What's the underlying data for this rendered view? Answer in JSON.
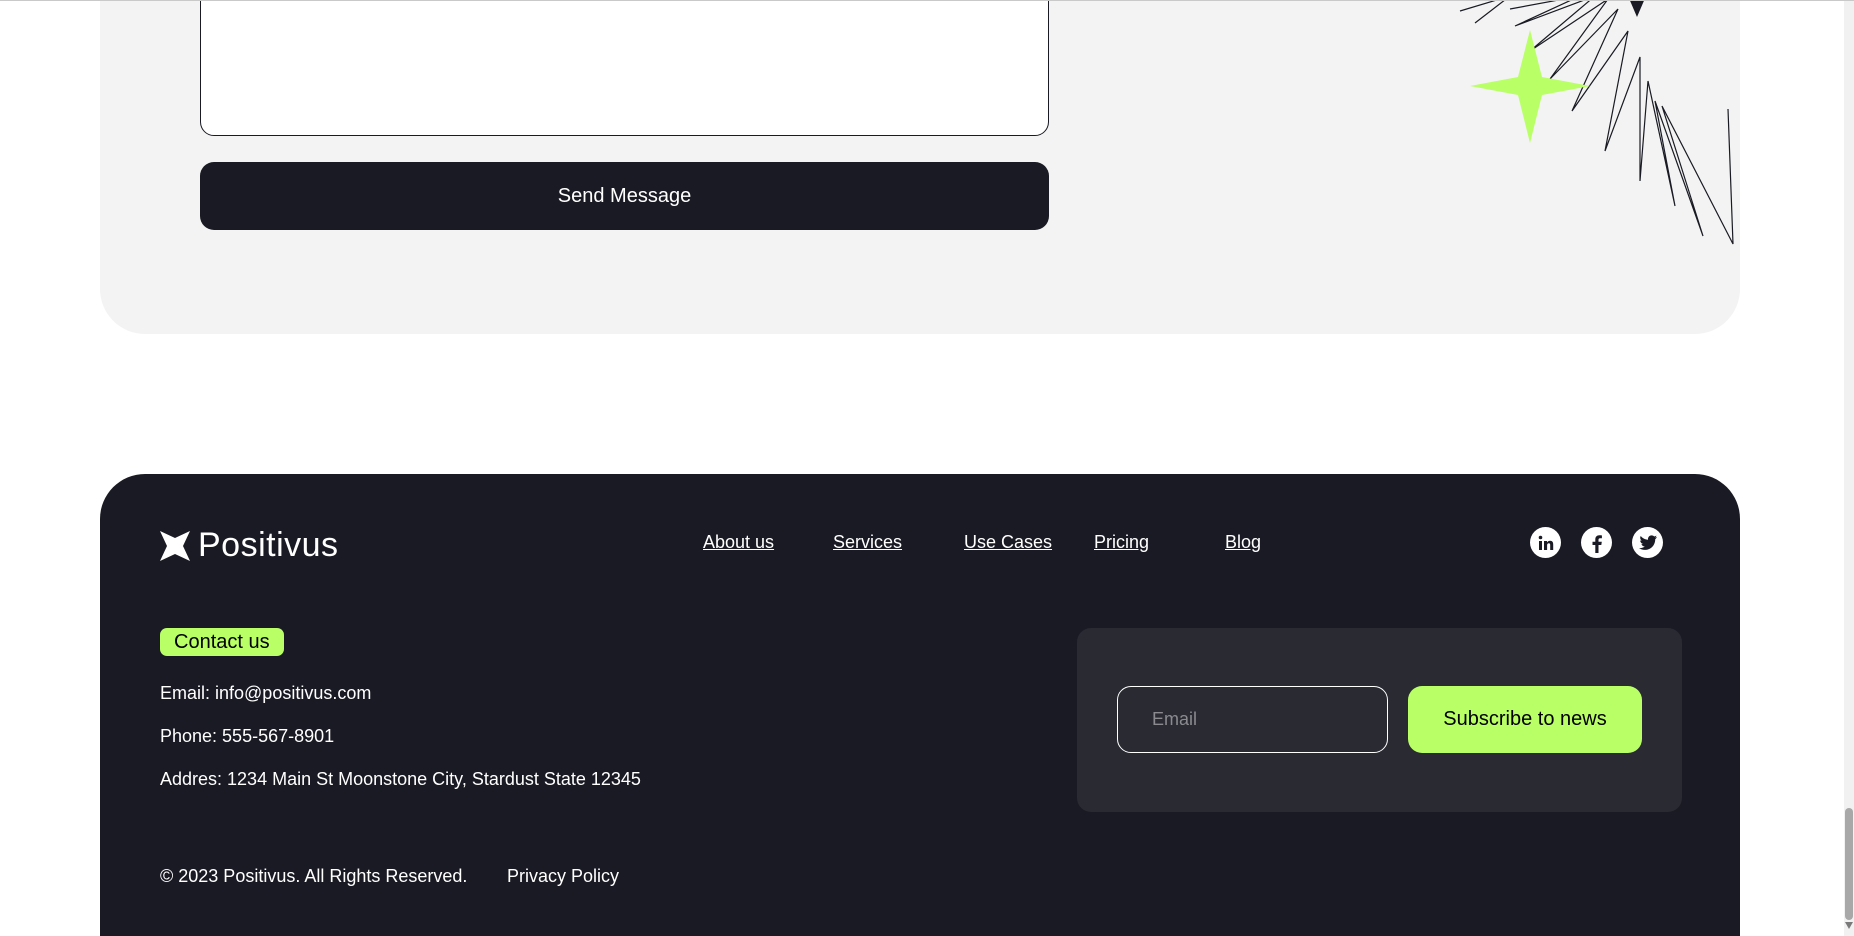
{
  "contact_form": {
    "send_label": "Send Message"
  },
  "footer": {
    "brand": "Positivus",
    "nav": [
      "About us",
      "Services",
      "Use Cases",
      "Pricing",
      "Blog"
    ],
    "socials": [
      "linkedin-icon",
      "facebook-icon",
      "twitter-icon"
    ],
    "contact_heading": "Contact us",
    "email": "Email: info@positivus.com",
    "phone": "Phone: 555-567-8901",
    "address": "Addres: 1234 Main St Moonstone City, Stardust State 12345",
    "subscribe": {
      "email_placeholder": "Email",
      "button_label": "Subscribe to news"
    },
    "copyright": "© 2023 Positivus. All Rights Reserved.",
    "privacy": "Privacy Policy"
  },
  "colors": {
    "accent": "#b9ff66",
    "dark": "#191a23",
    "panel": "#292a32",
    "card": "#f3f3f3"
  }
}
